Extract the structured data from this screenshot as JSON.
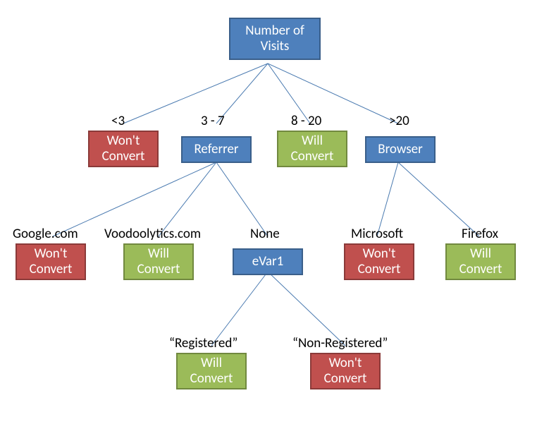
{
  "root": {
    "line1": "Number of",
    "line2": "Visits"
  },
  "branches": {
    "lt3": {
      "label": "<3",
      "node_l1": "Won't",
      "node_l2": "Convert"
    },
    "r3_7": {
      "label": "3 - 7",
      "node": "Referrer"
    },
    "r8_20": {
      "label": "8 - 20",
      "node_l1": "Will",
      "node_l2": "Convert"
    },
    "gt20": {
      "label": ">20",
      "node": "Browser"
    }
  },
  "referrer": {
    "google": {
      "label": "Google.com",
      "node_l1": "Won't",
      "node_l2": "Convert"
    },
    "voodoo": {
      "label": "Voodoolytics.com",
      "node_l1": "Will",
      "node_l2": "Convert"
    },
    "none": {
      "label": "None",
      "node": "eVar1"
    }
  },
  "browser": {
    "microsoft": {
      "label": "Microsoft",
      "node_l1": "Won't",
      "node_l2": "Convert"
    },
    "firefox": {
      "label": "Firefox",
      "node_l1": "Will",
      "node_l2": "Convert"
    }
  },
  "evar1": {
    "registered": {
      "label": "“Registered”",
      "node_l1": "Will",
      "node_l2": "Convert"
    },
    "nonregistered": {
      "label": "“Non-Registered”",
      "node_l1": "Won't",
      "node_l2": "Convert"
    }
  }
}
